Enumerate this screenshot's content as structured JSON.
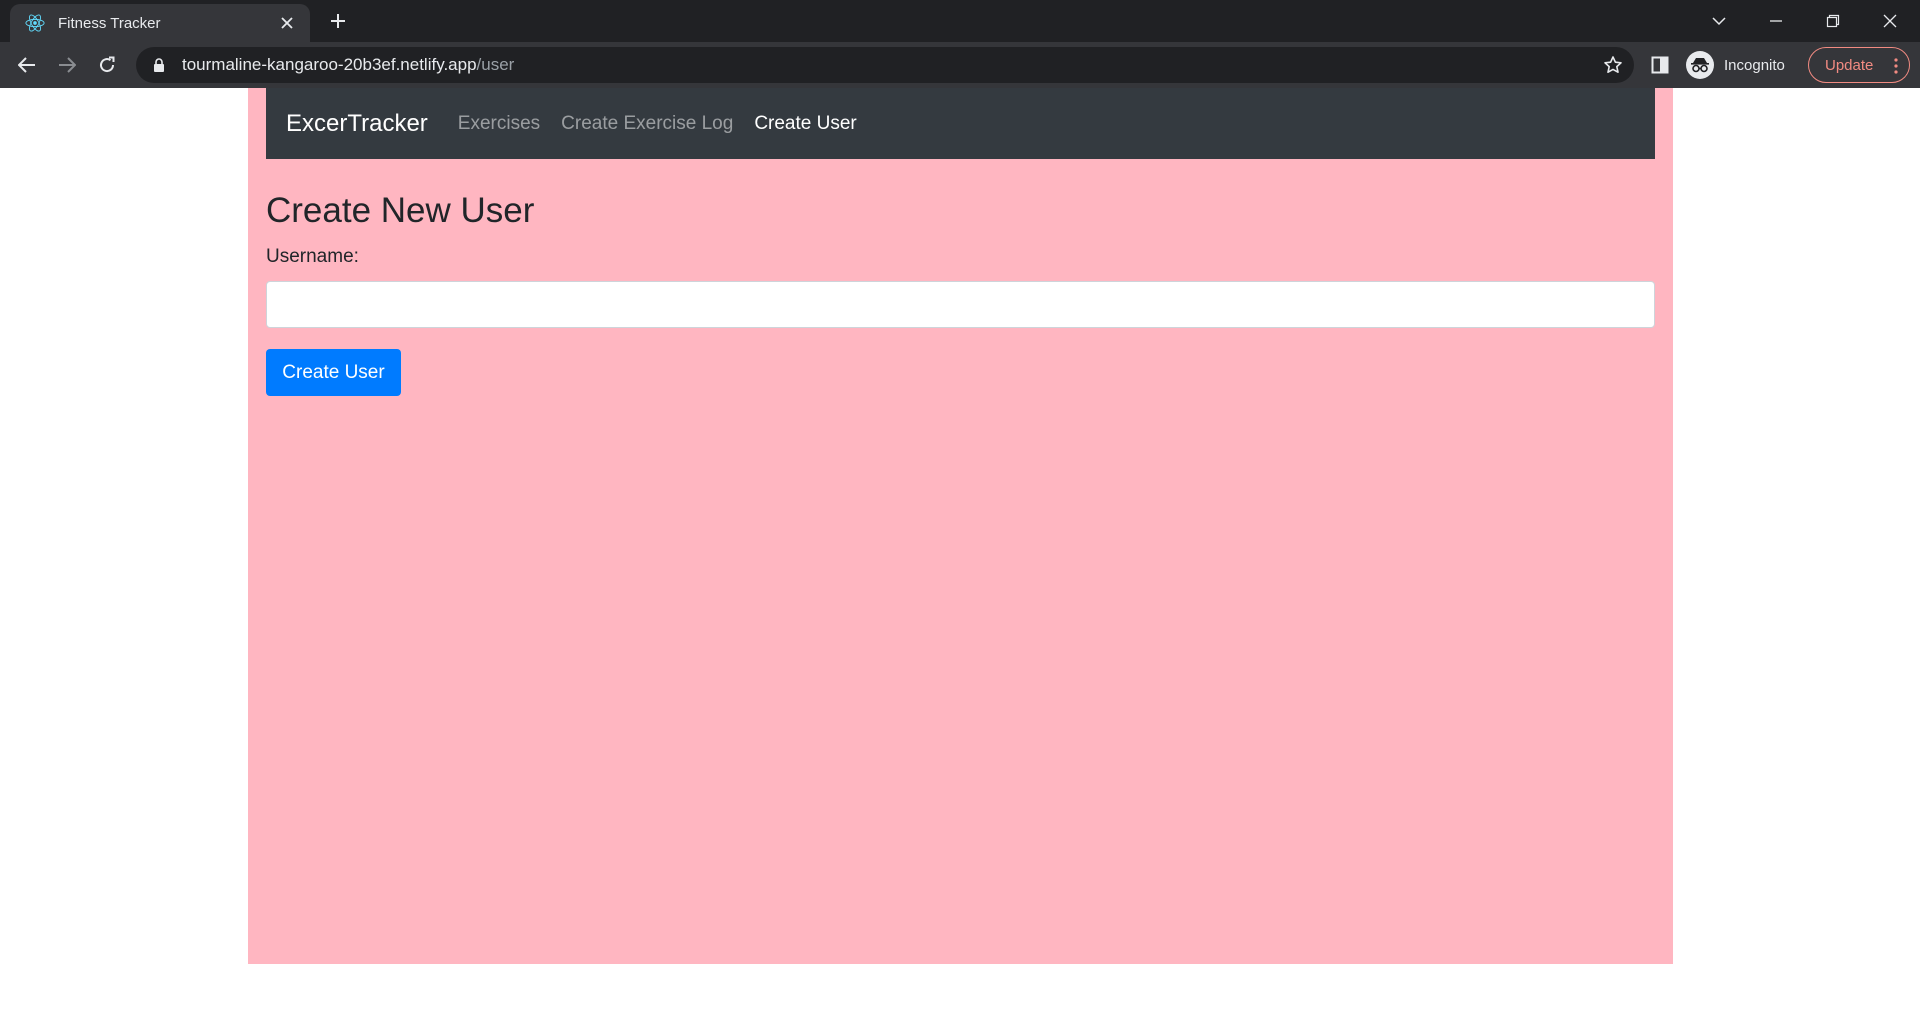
{
  "browser": {
    "tab": {
      "title": "Fitness Tracker",
      "favicon": "react-icon"
    },
    "address": {
      "host": "tourmaline-kangaroo-20b3ef.netlify.app",
      "path": "/user"
    },
    "profile_label": "Incognito",
    "update_label": "Update"
  },
  "navbar": {
    "brand": "ExcerTracker",
    "links": [
      {
        "label": "Exercises",
        "active": false
      },
      {
        "label": "Create Exercise Log",
        "active": false
      },
      {
        "label": "Create User",
        "active": true
      }
    ]
  },
  "form": {
    "heading": "Create New User",
    "username_label": "Username:",
    "username_value": "",
    "submit_label": "Create User"
  },
  "colors": {
    "page_background": "#ffb6c1",
    "navbar": "#343a40",
    "primary_button": "#007bff"
  }
}
